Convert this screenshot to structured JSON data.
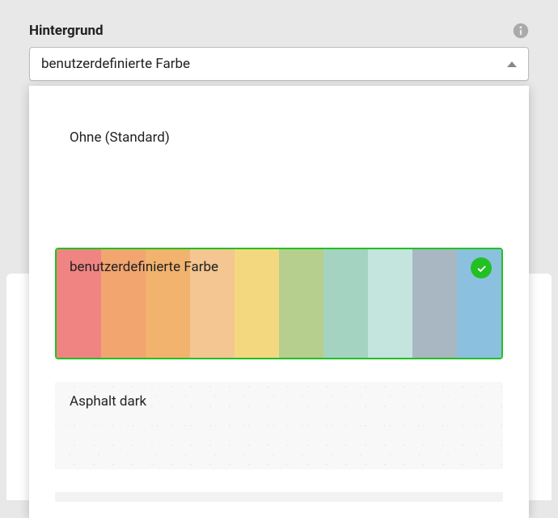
{
  "header": {
    "label": "Hintergrund"
  },
  "select": {
    "current": "benutzerdefinierte Farbe"
  },
  "options": {
    "plain": {
      "label": "Ohne (Standard)"
    },
    "custom_color": {
      "label": "benutzerdefinierte Farbe",
      "selected": true,
      "stripes": [
        "#f08482",
        "#f2a56f",
        "#f1b36e",
        "#f4c691",
        "#f4d87f",
        "#b6ce8e",
        "#a4d4c1",
        "#c3e5dd",
        "#a9b7c3",
        "#8bc1de"
      ]
    },
    "asphalt": {
      "label": "Asphalt dark"
    }
  }
}
